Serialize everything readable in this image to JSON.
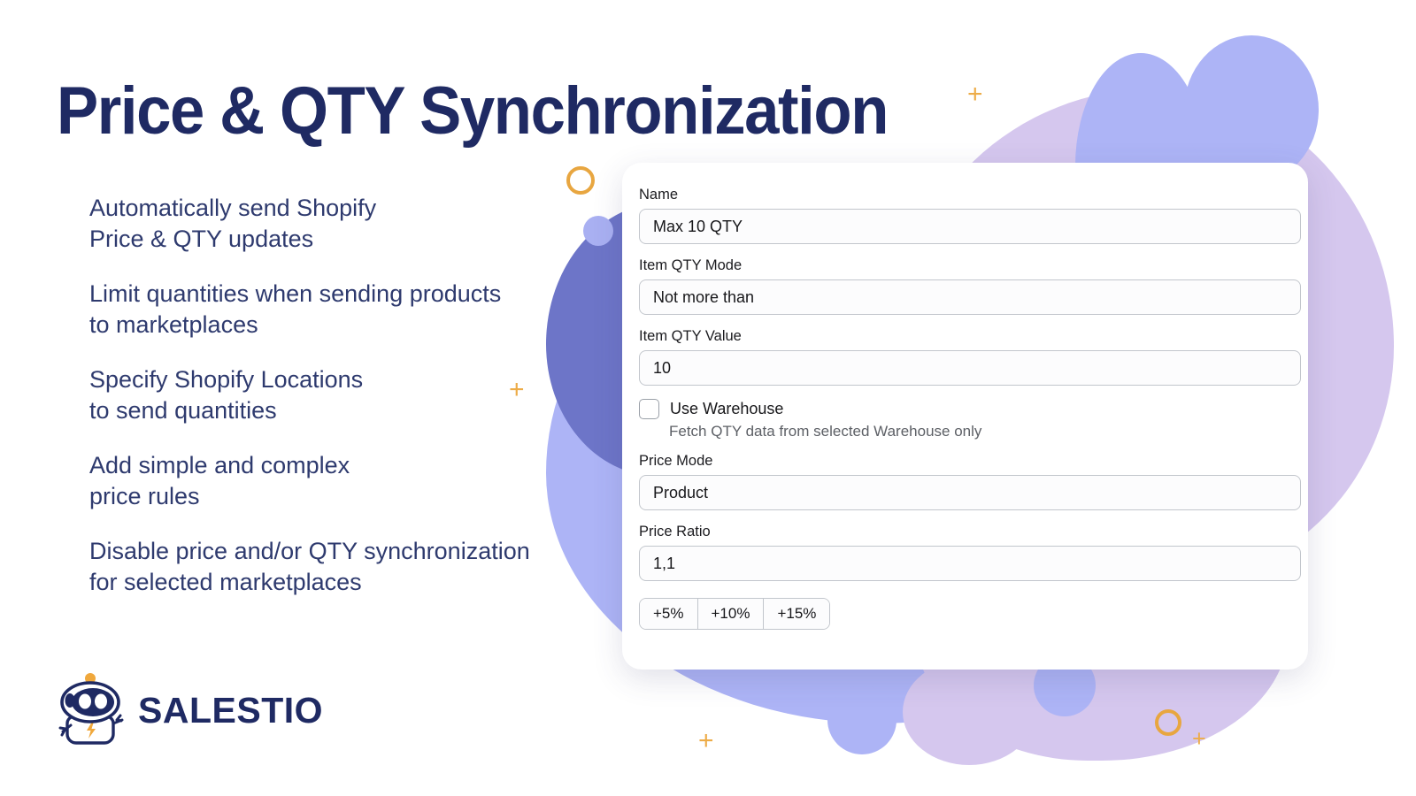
{
  "headline": "Price & QTY Synchronization",
  "bullets": [
    "Automatically send Shopify\nPrice & QTY updates",
    "Limit quantities when sending products\nto marketplaces",
    "Specify Shopify Locations\nto send quantities",
    "Add simple and complex\nprice rules",
    "Disable price and/or QTY synchronization\nfor selected marketplaces"
  ],
  "logo": {
    "wordmark": "SALESTIO",
    "mascot": "robot-mascot-icon"
  },
  "form": {
    "fields": [
      {
        "label": "Name",
        "value": "Max 10 QTY"
      },
      {
        "label": "Item QTY Mode",
        "value": "Not more than"
      },
      {
        "label": "Item QTY Value",
        "value": "10"
      }
    ],
    "checkbox": {
      "label": "Use Warehouse",
      "checked": false,
      "helper": "Fetch QTY data from selected Warehouse only"
    },
    "price_fields": [
      {
        "label": "Price Mode",
        "value": "Product"
      },
      {
        "label": "Price Ratio",
        "value": "1,1"
      }
    ],
    "quick_ratio_buttons": [
      "+5%",
      "+10%",
      "+15%"
    ]
  },
  "colors": {
    "navy": "#1f2a63",
    "body_text": "#2e3a6e",
    "periwinkle": "#adb4f6",
    "slate_blue": "#6d75c8",
    "lavender": "#d5c7ee",
    "orange": "#e8a640",
    "card_bg": "#ffffff"
  }
}
